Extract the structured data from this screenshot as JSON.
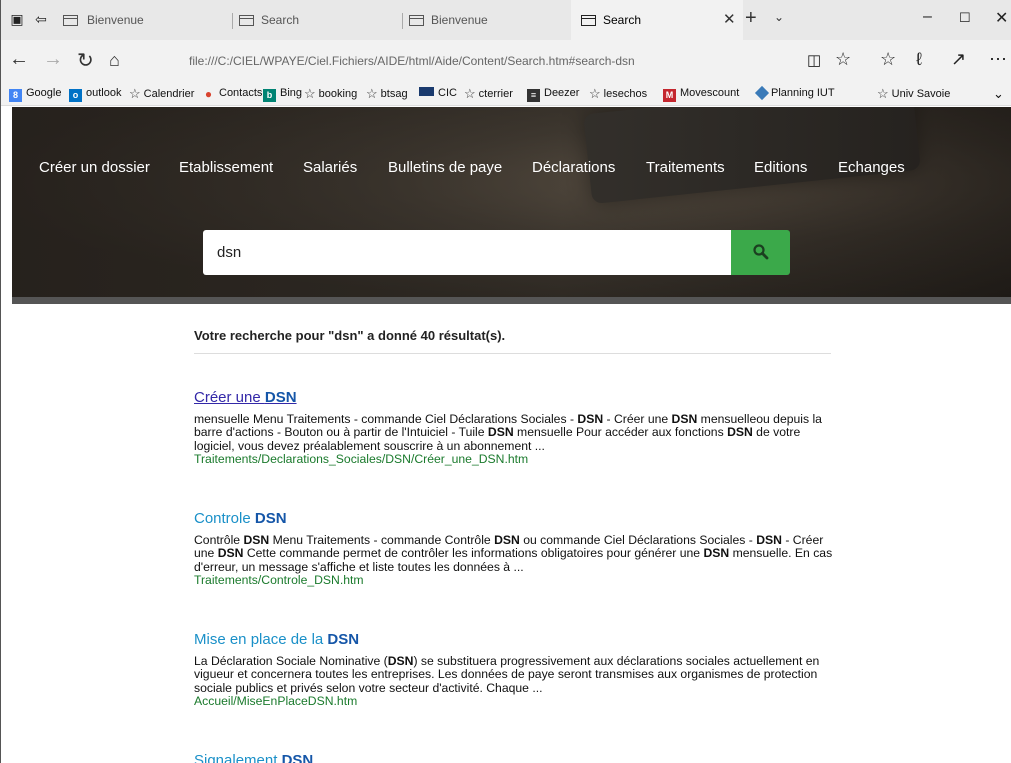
{
  "browser": {
    "tabs": [
      {
        "label": "Bienvenue",
        "active": false
      },
      {
        "label": "Search",
        "active": false
      },
      {
        "label": "Bienvenue",
        "active": false
      },
      {
        "label": "Search",
        "active": true
      }
    ],
    "url": "file:///C:/CIEL/WPAYE/Ciel.Fichiers/AIDE/html/Aide/Content/Search.htm#search-dsn",
    "favorites": [
      {
        "label": "Google",
        "icon": "google-icon",
        "color": "#4285f4"
      },
      {
        "label": "outlook",
        "icon": "outlook-icon",
        "color": "#0072c6"
      },
      {
        "label": "Calendrier",
        "icon": "star-icon"
      },
      {
        "label": "Contacts",
        "icon": "contacts-icon",
        "color": "#d9432f"
      },
      {
        "label": "Bing",
        "icon": "bing-icon",
        "color": "#008373"
      },
      {
        "label": "booking",
        "icon": "star-icon"
      },
      {
        "label": "btsag",
        "icon": "star-icon"
      },
      {
        "label": "CIC",
        "icon": "cic-icon",
        "color": "#1a3a6e"
      },
      {
        "label": "cterrier",
        "icon": "star-icon"
      },
      {
        "label": "Deezer",
        "icon": "deezer-icon",
        "color": "#333333"
      },
      {
        "label": "lesechos",
        "icon": "star-icon"
      },
      {
        "label": "Movescount",
        "icon": "movescount-icon",
        "color": "#c4262e"
      },
      {
        "label": "Planning IUT",
        "icon": "planning-icon",
        "color": "#3a7ab8"
      },
      {
        "label": "Univ Savoie",
        "icon": "star-icon"
      }
    ]
  },
  "site": {
    "menu": [
      "Créer un dossier",
      "Etablissement",
      "Salariés",
      "Bulletins de paye",
      "Déclarations",
      "Traitements",
      "Editions",
      "Echanges"
    ],
    "search_value": "dsn",
    "search_button_color": "#3ba94a",
    "summary": "Votre recherche pour \"dsn\" a donné 40 résultat(s).",
    "results": [
      {
        "title_parts": [
          {
            "t": "Créer une ",
            "b": false
          },
          {
            "t": "DSN",
            "b": true
          }
        ],
        "visited": true,
        "snippet": [
          {
            "t": "mensuelle Menu Traitements - commande Ciel Déclarations Sociales - ",
            "b": false
          },
          {
            "t": "DSN",
            "b": true
          },
          {
            "t": " - Créer une ",
            "b": false
          },
          {
            "t": "DSN",
            "b": true
          },
          {
            "t": " mensuelleou depuis la barre d'actions - Bouton ou à partir de l'Intuiciel - Tuile ",
            "b": false
          },
          {
            "t": "DSN",
            "b": true
          },
          {
            "t": " mensuelle Pour accéder aux fonctions ",
            "b": false
          },
          {
            "t": "DSN",
            "b": true
          },
          {
            "t": " de votre logiciel, vous devez préalablement souscrire à un abonnement ...",
            "b": false
          }
        ],
        "path": "Traitements/Declarations_Sociales/DSN/Créer_une_DSN.htm"
      },
      {
        "title_parts": [
          {
            "t": "Controle ",
            "b": false
          },
          {
            "t": "DSN",
            "b": true
          }
        ],
        "visited": false,
        "snippet": [
          {
            "t": "Contrôle ",
            "b": false
          },
          {
            "t": "DSN",
            "b": true
          },
          {
            "t": " Menu Traitements - commande Contrôle ",
            "b": false
          },
          {
            "t": "DSN",
            "b": true
          },
          {
            "t": " ou commande Ciel Déclarations Sociales - ",
            "b": false
          },
          {
            "t": "DSN",
            "b": true
          },
          {
            "t": " - Créer une ",
            "b": false
          },
          {
            "t": "DSN",
            "b": true
          },
          {
            "t": " Cette commande permet de contrôler les informations obligatoires pour générer une ",
            "b": false
          },
          {
            "t": "DSN",
            "b": true
          },
          {
            "t": " mensuelle. En cas d'erreur, un message s'affiche et liste toutes les données à ...",
            "b": false
          }
        ],
        "path": "Traitements/Controle_DSN.htm"
      },
      {
        "title_parts": [
          {
            "t": "Mise en place de la ",
            "b": false
          },
          {
            "t": "DSN",
            "b": true
          }
        ],
        "visited": false,
        "snippet": [
          {
            "t": "La Déclaration Sociale Nominative (",
            "b": false
          },
          {
            "t": "DSN",
            "b": true
          },
          {
            "t": ") se substituera progressivement aux déclarations sociales actuellement en vigueur et concernera toutes les entreprises. Les données de paye seront transmises aux organismes de protection sociale publics et privés selon votre secteur d'activité. Chaque ...",
            "b": false
          }
        ],
        "path": "Accueil/MiseEnPlaceDSN.htm"
      },
      {
        "title_parts": [
          {
            "t": "Signalement ",
            "b": false
          },
          {
            "t": "DSN",
            "b": true
          }
        ],
        "visited": false,
        "snippet": [],
        "path": ""
      }
    ]
  }
}
